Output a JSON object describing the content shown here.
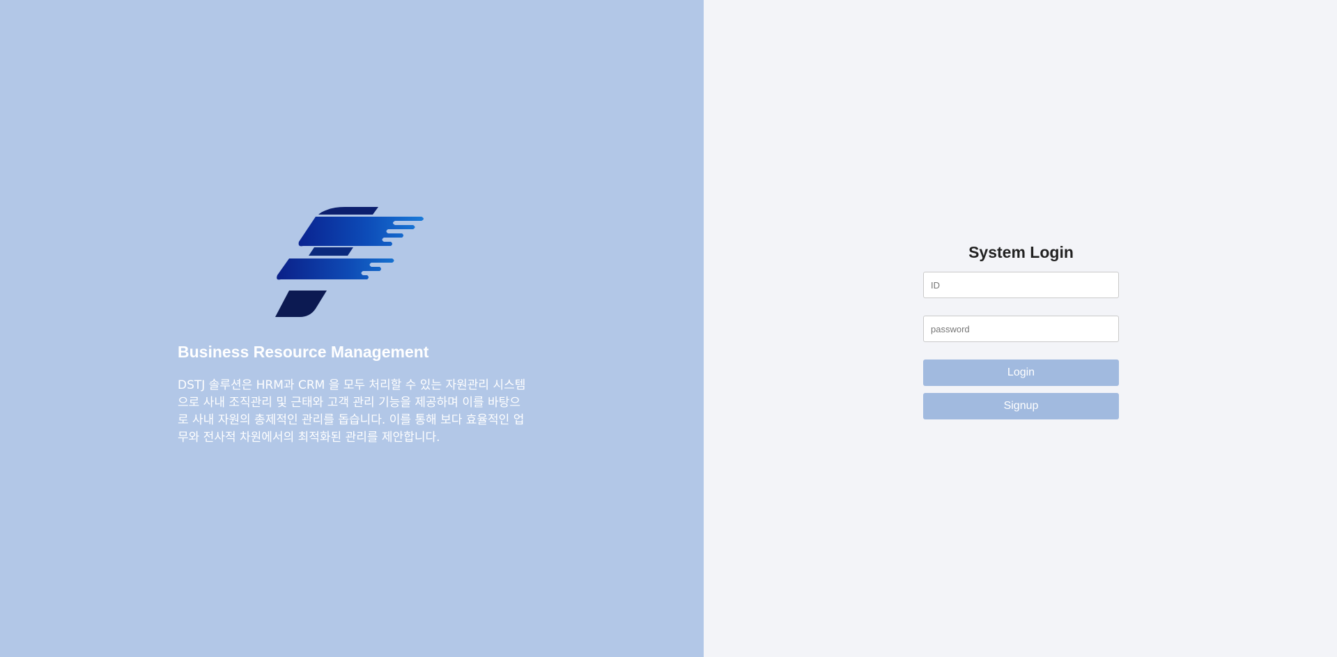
{
  "brand": {
    "title": "Business Resource Management",
    "description": "DSTJ 솔루션은 HRM과 CRM 을 모두 처리할 수 있는 자원관리 시스템으로 사내 조직관리 및 근태와 고객 관리 기능을 제공하며 이를 바탕으로 사내 자원의 총제적인 관리를 돕습니다. 이를 통해 보다 효율적인 업무와 전사적 차원에서의 최적화된 관리를 제안합니다."
  },
  "login": {
    "title": "System Login",
    "id_placeholder": "ID",
    "id_value": "",
    "password_placeholder": "password",
    "password_value": "",
    "login_label": "Login",
    "signup_label": "Signup"
  },
  "colors": {
    "left_panel_bg": "#b2c7e7",
    "right_panel_bg": "#f3f4f8",
    "button_bg": "#a1badf",
    "logo_dark": "#0b1a56",
    "logo_mid": "#0a2fa0",
    "logo_light": "#1a74d6"
  },
  "icons": {
    "logo": "winged-f-logo-icon"
  }
}
